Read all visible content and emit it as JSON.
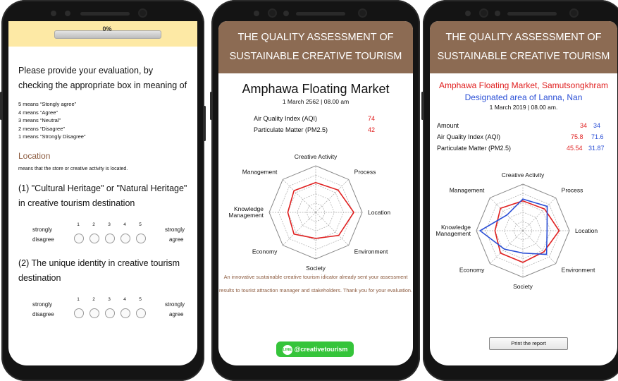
{
  "survey": {
    "progress_label": "0%",
    "progress_fraction": 0,
    "instruction": "Please provide your evaluation, by checking the appropriate box in meaning of",
    "means": [
      "5 means “Stongly agree”",
      "4 means “Agree”",
      "3 means “Neutral”",
      "2 means “Disagree”",
      "1 means “Strongly Disagree”"
    ],
    "section_title": "Location",
    "section_desc": "means that the store or creative activity is located.",
    "questions": [
      {
        "text": "(1) \"Cultural Heritage\" or \"Natural Heritage\" in creative tourism destination"
      },
      {
        "text": "(2) The unique identity in creative tourism destination"
      }
    ],
    "scale": {
      "left_top": "strongly",
      "left_bottom": "disagree",
      "right_top": "strongly",
      "right_bottom": "agree",
      "numbers": [
        "1",
        "2",
        "3",
        "4",
        "5"
      ]
    }
  },
  "result": {
    "header": "THE QUALITY ASSESSMENT OF SUSTAINABLE CREATIVE TOURISM",
    "venue": "Amphawa Floating Market",
    "date": "1 March 2562 | 08.00 am",
    "metrics": [
      {
        "label": "Air Quality Index (AQI)",
        "value": "74"
      },
      {
        "label": "Particulate Matter (PM2.5)",
        "value": "42"
      }
    ],
    "message": "An innovative sustainable creative tourism idicator already sent your assessment results to tourist attraction manager and stakeholders. Thank you for your evaluation.",
    "line_button": "@creativetourism",
    "line_badge": "LINE"
  },
  "report": {
    "header": "THE QUALITY ASSESSMENT OF SUSTAINABLE CREATIVE TOURISM",
    "venue_a": "Amphawa Floating Market, Samutsongkhram",
    "venue_b": "Designated area of Lanna, Nan",
    "date": "1 March 2019 | 08.00 am.",
    "rows": [
      {
        "label": "Amount",
        "a": "34",
        "b": "34"
      },
      {
        "label": "Air Quality Index (AQI)",
        "a": "75.8",
        "b": "71.6"
      },
      {
        "label": "Particulate Matter (PM2.5)",
        "a": "45.54",
        "b": "31.87"
      }
    ],
    "print_button": "Print the report"
  },
  "colors": {
    "header_brown": "#8c6b53",
    "series_red": "#e02020",
    "series_blue": "#2a4fd6",
    "line_green": "#35c43a",
    "progress_bg": "#fde9a5"
  },
  "chart_data": [
    {
      "type": "radar",
      "axes": [
        "Creative Activity",
        "Process",
        "Location",
        "Environment",
        "Society",
        "Economy",
        "Knowledge Management",
        "Management"
      ],
      "rmax": 5,
      "rings": 5,
      "series": [
        {
          "values": [
            3.2,
            3.4,
            4.1,
            3.5,
            2.8,
            3.3,
            3.0,
            3.3
          ],
          "color": "#e02020"
        }
      ]
    },
    {
      "type": "radar",
      "axes": [
        "Creative Activity",
        "Process",
        "Location",
        "Environment",
        "Society",
        "Economy",
        "Knowledge Management",
        "Management"
      ],
      "rmax": 5,
      "rings": 5,
      "series": [
        {
          "values": [
            3.2,
            3.3,
            3.9,
            3.2,
            3.4,
            3.4,
            3.0,
            3.4
          ],
          "color": "#e02020"
        },
        {
          "values": [
            3.4,
            3.7,
            2.6,
            3.6,
            2.4,
            2.8,
            4.6,
            2.4
          ],
          "color": "#2a4fd6"
        }
      ]
    }
  ]
}
